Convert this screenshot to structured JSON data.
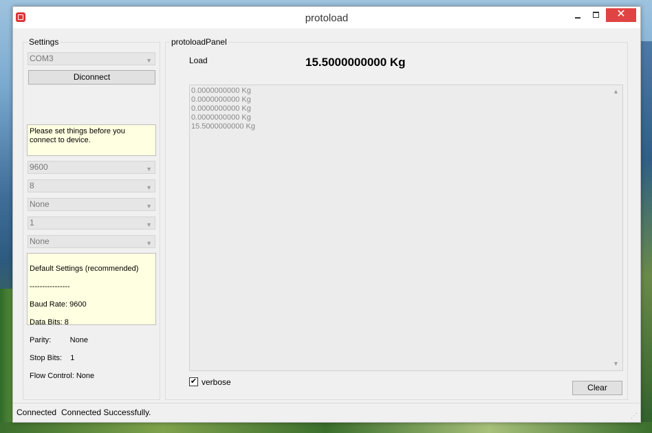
{
  "window": {
    "title": "protoload"
  },
  "settings": {
    "legend": "Settings",
    "port": "COM3",
    "disconnect_label": "Diconnect",
    "info_text": "Please set things before you connect to device.",
    "baud": "9600",
    "data_bits": "8",
    "parity": "None",
    "stop_bits": "1",
    "flow_control": "None",
    "defaults": {
      "heading": "Default Settings (recommended)",
      "separator": "----------------",
      "baud": "Baud Rate: 9600",
      "data_bits": "Data Bits:   8",
      "parity": "Parity:         None",
      "stop_bits": "Stop Bits:    1",
      "flow": "Flow Control: None"
    }
  },
  "panel": {
    "legend": "protoloadPanel",
    "load_label": "Load",
    "load_value": "15.5000000000 Kg",
    "log_lines": [
      "0.0000000000 Kg",
      "0.0000000000 Kg",
      "0.0000000000 Kg",
      "0.0000000000 Kg",
      "15.5000000000 Kg"
    ],
    "verbose_label": "verbose",
    "verbose_checked": true,
    "clear_label": "Clear"
  },
  "status": {
    "state": "Connected",
    "message": "Connected Successfully."
  },
  "icons": {
    "combo_arrow": "chevron-down-icon",
    "minimize": "minimize-icon",
    "maximize": "maximize-icon",
    "close": "close-icon",
    "check": "checkmark-icon",
    "grip": "resize-grip-icon"
  },
  "colors": {
    "note_bg": "#ffffe1",
    "close_bg": "#e04343",
    "app_icon": "#d9353a"
  }
}
